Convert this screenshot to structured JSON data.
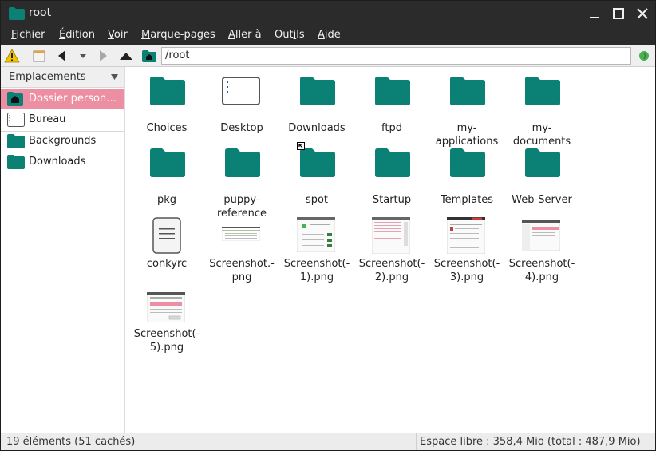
{
  "window": {
    "title": "root"
  },
  "menu": {
    "fichier": {
      "accel": "F",
      "rest": "ichier"
    },
    "edition": {
      "accel": "É",
      "rest": "dition"
    },
    "voir": {
      "accel": "V",
      "rest": "oir"
    },
    "marque": {
      "accel": "M",
      "rest": "arque-pages"
    },
    "aller": {
      "accel": "A",
      "rest": "ller à"
    },
    "outils_a": "Out",
    "outils_accel": "i",
    "outils_b": "ls",
    "aide": {
      "accel": "A",
      "rest": "ide"
    }
  },
  "toolbar": {
    "location": "/root"
  },
  "sidebar": {
    "header": "Emplacements",
    "items": [
      {
        "label": "Dossier person…",
        "icon": "home-folder-icon"
      },
      {
        "label": "Bureau",
        "icon": "desktop-icon"
      },
      {
        "label": "Backgrounds",
        "icon": "folder-icon"
      },
      {
        "label": "Downloads",
        "icon": "folder-icon"
      }
    ]
  },
  "files": [
    {
      "name": "Choices",
      "icon": "folder"
    },
    {
      "name": "Desktop",
      "icon": "desktop"
    },
    {
      "name": "Downloads",
      "icon": "folder"
    },
    {
      "name": "ftpd",
      "icon": "folder"
    },
    {
      "name": "my-\napplications",
      "icon": "folder"
    },
    {
      "name": "my-\ndocuments",
      "icon": "folder"
    },
    {
      "name": "pkg",
      "icon": "folder"
    },
    {
      "name": "puppy-\nreference",
      "icon": "folder"
    },
    {
      "name": "spot",
      "icon": "folder"
    },
    {
      "name": "Startup",
      "icon": "folder"
    },
    {
      "name": "Templates",
      "icon": "folder"
    },
    {
      "name": "Web-Server",
      "icon": "folder"
    },
    {
      "name": "conkyrc",
      "icon": "text-file"
    },
    {
      "name": "Screenshot.-\npng",
      "icon": "image-thumb"
    },
    {
      "name": "Screenshot(-\n1).png",
      "icon": "image-thumb"
    },
    {
      "name": "Screenshot(-\n2).png",
      "icon": "image-thumb"
    },
    {
      "name": "Screenshot(-\n3).png",
      "icon": "image-thumb"
    },
    {
      "name": "Screenshot(-\n4).png",
      "icon": "image-thumb"
    },
    {
      "name": "Screenshot(-\n5).png",
      "icon": "image-thumb"
    }
  ],
  "status": {
    "left": "19 éléments (51 cachés)",
    "right": "Espace libre : 358,4 Mio (total : 487,9 Mio)"
  },
  "colors": {
    "folder": "#0b8074",
    "selection": "#ec8fa3",
    "chrome": "#2b2b2b"
  }
}
